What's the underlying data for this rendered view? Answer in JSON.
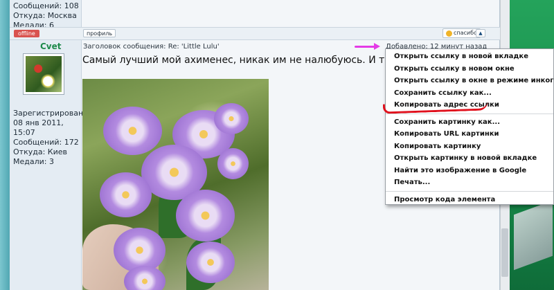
{
  "previous_user": {
    "messages": "Сообщений: 108",
    "from": "Откуда: Москва",
    "medals": "Медали: 6",
    "status": "offline"
  },
  "post_toolbar": {
    "profile_label": "профиль",
    "thanks_label": "спасибо",
    "up_label": "▲"
  },
  "post": {
    "username": "Cvet",
    "subject": "Заголовок сообщения: Re: 'Little Lulu'",
    "added": "Добавлено: 12 минут назад",
    "text": "Самый лучший мой ахименес, никак им не налюбуюсь. И трудяга!",
    "user_info": [
      "Зарегистрирован:",
      "08 янв 2011,",
      "15:07",
      "Сообщений: 172",
      "Откуда: Киев",
      "Медали: 3"
    ]
  },
  "context_menu": {
    "group1": [
      "Открыть ссылку в новой вкладке",
      "Открыть ссылку в новом окне",
      "Открыть ссылку в окне в режиме инкогнито",
      "Сохранить ссылку как...",
      "Копировать адрес ссылки"
    ],
    "group2": [
      "Сохранить картинку как...",
      "Копировать URL картинки",
      "Копировать картинку",
      "Открыть картинку в новой вкладке",
      "Найти это изображение в Google",
      "Печать..."
    ],
    "group3": [
      "Просмотр кода элемента"
    ]
  },
  "annotations": {
    "arrow_color": "#e43be6",
    "underline_color": "#e0101c"
  }
}
